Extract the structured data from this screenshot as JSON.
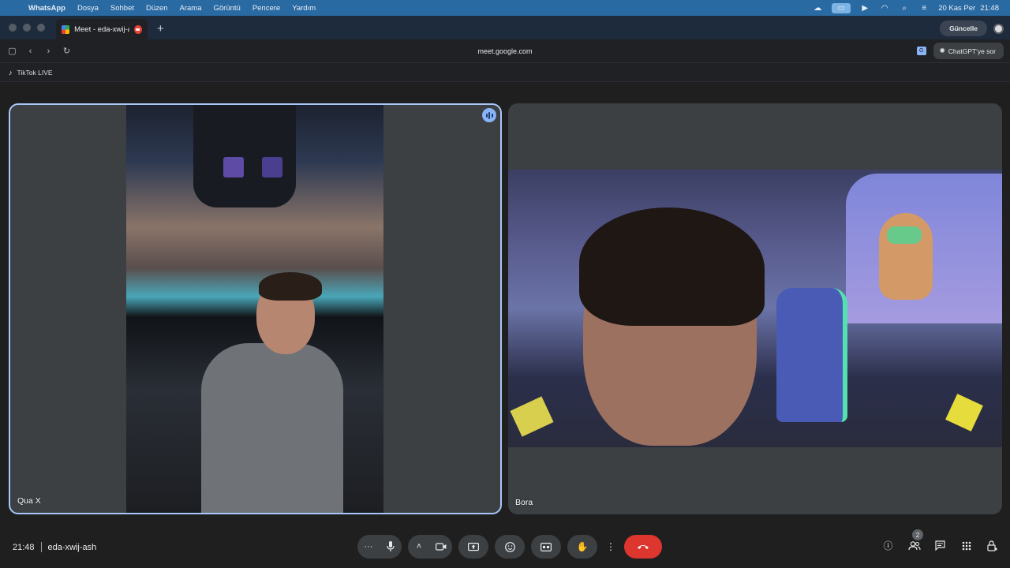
{
  "menubar": {
    "app_name": "WhatsApp",
    "items": [
      "Dosya",
      "Sohbet",
      "Düzen",
      "Arama",
      "Görüntü",
      "Pencere",
      "Yardım"
    ],
    "date": "20 Kas Per",
    "time": "21:48"
  },
  "browser": {
    "tab_title": "Meet - eda-xwij-ash",
    "update_label": "Güncelle",
    "url": "meet.google.com",
    "chatgpt_label": "ChatGPT'ye sor",
    "bookmark_label": "TikTok LIVE"
  },
  "meet": {
    "participants": [
      {
        "name": "Qua X",
        "speaking": true
      },
      {
        "name": "Bora",
        "speaking": false
      }
    ],
    "time": "21:48",
    "meeting_code": "eda-xwij-ash",
    "participant_count": "2"
  },
  "colors": {
    "menubar": "#2a6aa3",
    "active_speaker_border": "#a8c7fa",
    "end_call": "#dc362e"
  },
  "icons": {
    "mic": "microphone-icon",
    "camera": "camera-icon",
    "present": "present-screen-icon",
    "emoji": "emoji-icon",
    "captions": "captions-icon",
    "raise_hand": "raise-hand-icon",
    "end_call": "end-call-icon"
  }
}
